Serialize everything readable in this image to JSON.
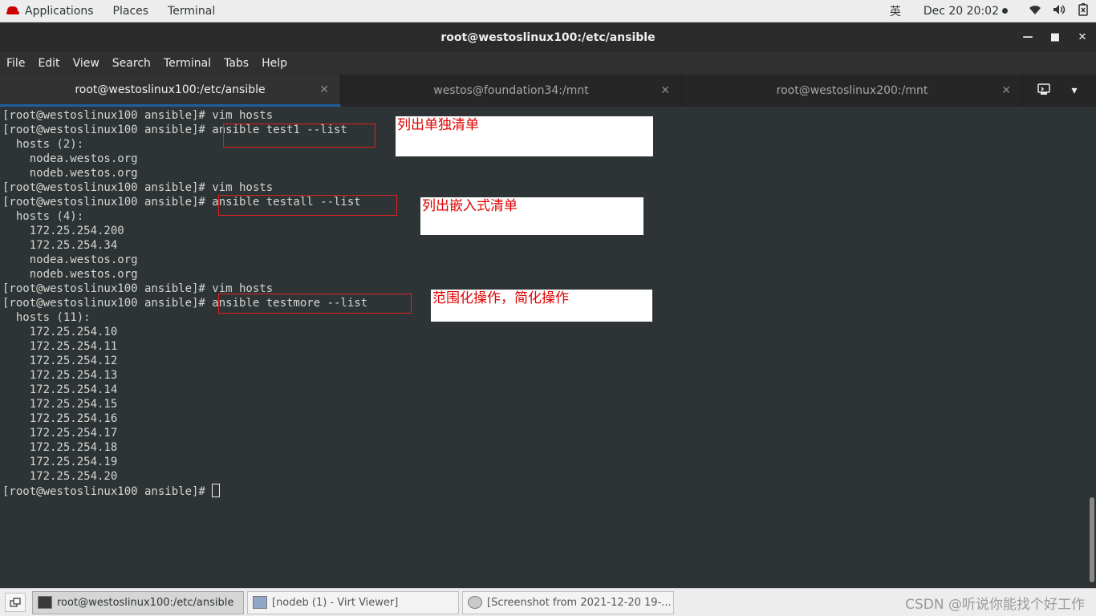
{
  "topbar": {
    "applications": "Applications",
    "places": "Places",
    "terminal": "Terminal",
    "input_method": "英",
    "datetime": "Dec 20  20:02",
    "icons": [
      "wifi-icon",
      "volume-icon",
      "battery-icon"
    ]
  },
  "window": {
    "title": "root@westoslinux100:/etc/ansible"
  },
  "menubar": {
    "items": [
      "File",
      "Edit",
      "View",
      "Search",
      "Terminal",
      "Tabs",
      "Help"
    ]
  },
  "tabs": [
    {
      "label": "root@westoslinux100:/etc/ansible",
      "active": true
    },
    {
      "label": "westos@foundation34:/mnt",
      "active": false
    },
    {
      "label": "root@westoslinux200:/mnt",
      "active": false
    }
  ],
  "terminal": {
    "lines": [
      "[root@westoslinux100 ansible]# vim hosts",
      "[root@westoslinux100 ansible]# ansible test1 --list",
      "  hosts (2):",
      "    nodea.westos.org",
      "    nodeb.westos.org",
      "[root@westoslinux100 ansible]# vim hosts",
      "[root@westoslinux100 ansible]# ansible testall --list",
      "  hosts (4):",
      "    172.25.254.200",
      "    172.25.254.34",
      "    nodea.westos.org",
      "    nodeb.westos.org",
      "[root@westoslinux100 ansible]# vim hosts",
      "[root@westoslinux100 ansible]# ansible testmore --list",
      "  hosts (11):",
      "    172.25.254.10",
      "    172.25.254.11",
      "    172.25.254.12",
      "    172.25.254.13",
      "    172.25.254.14",
      "    172.25.254.15",
      "    172.25.254.16",
      "    172.25.254.17",
      "    172.25.254.18",
      "    172.25.254.19",
      "    172.25.254.20"
    ],
    "prompt": "[root@westoslinux100 ansible]# "
  },
  "annotations": {
    "note1": "列出单独清单",
    "note2": "列出嵌入式清单",
    "note3": "范围化操作，简化操作",
    "highlight_color": "#e02020"
  },
  "taskbar": {
    "items": [
      {
        "label": "root@westoslinux100:/etc/ansible",
        "active": true
      },
      {
        "label": "[nodeb (1) - Virt Viewer]",
        "active": false
      },
      {
        "label": "[Screenshot from 2021-12-20 19-...",
        "active": false
      }
    ],
    "watermark": "CSDN @听说你能找个好工作"
  }
}
